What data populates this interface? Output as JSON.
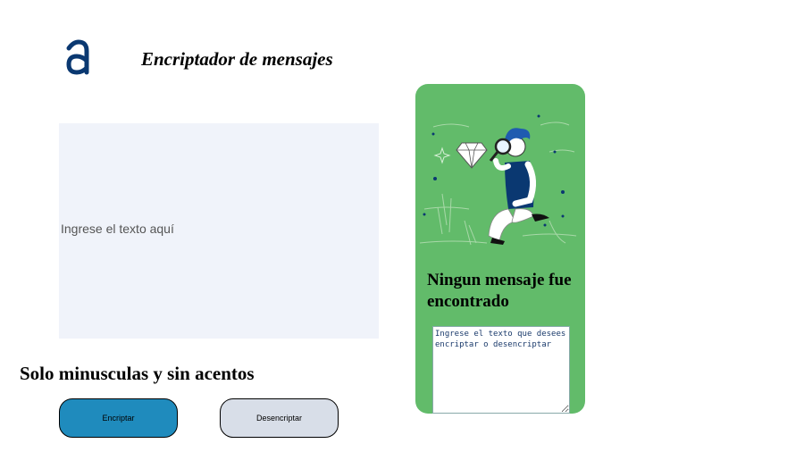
{
  "header": {
    "logo_icon": "alura-logo-icon",
    "title": "Encriptador de mensajes"
  },
  "input": {
    "placeholder": "Ingrese el texto aquí"
  },
  "hint": "Solo minusculas y sin acentos",
  "buttons": {
    "encrypt_label": "Encriptar",
    "decrypt_label": "Desencriptar"
  },
  "panel": {
    "illustration_icon": "person-with-magnifying-glass-icon",
    "title": "Ningun mensaje fue encontrado",
    "output_placeholder": "Ingrese el texto que desees encriptar o desencriptar"
  },
  "colors": {
    "brand": "#0a3871",
    "panel": "#62bb6a",
    "encrypt_button": "#1f8bbd",
    "decrypt_button": "#d8dee8",
    "input_background": "#f0f3fa"
  }
}
